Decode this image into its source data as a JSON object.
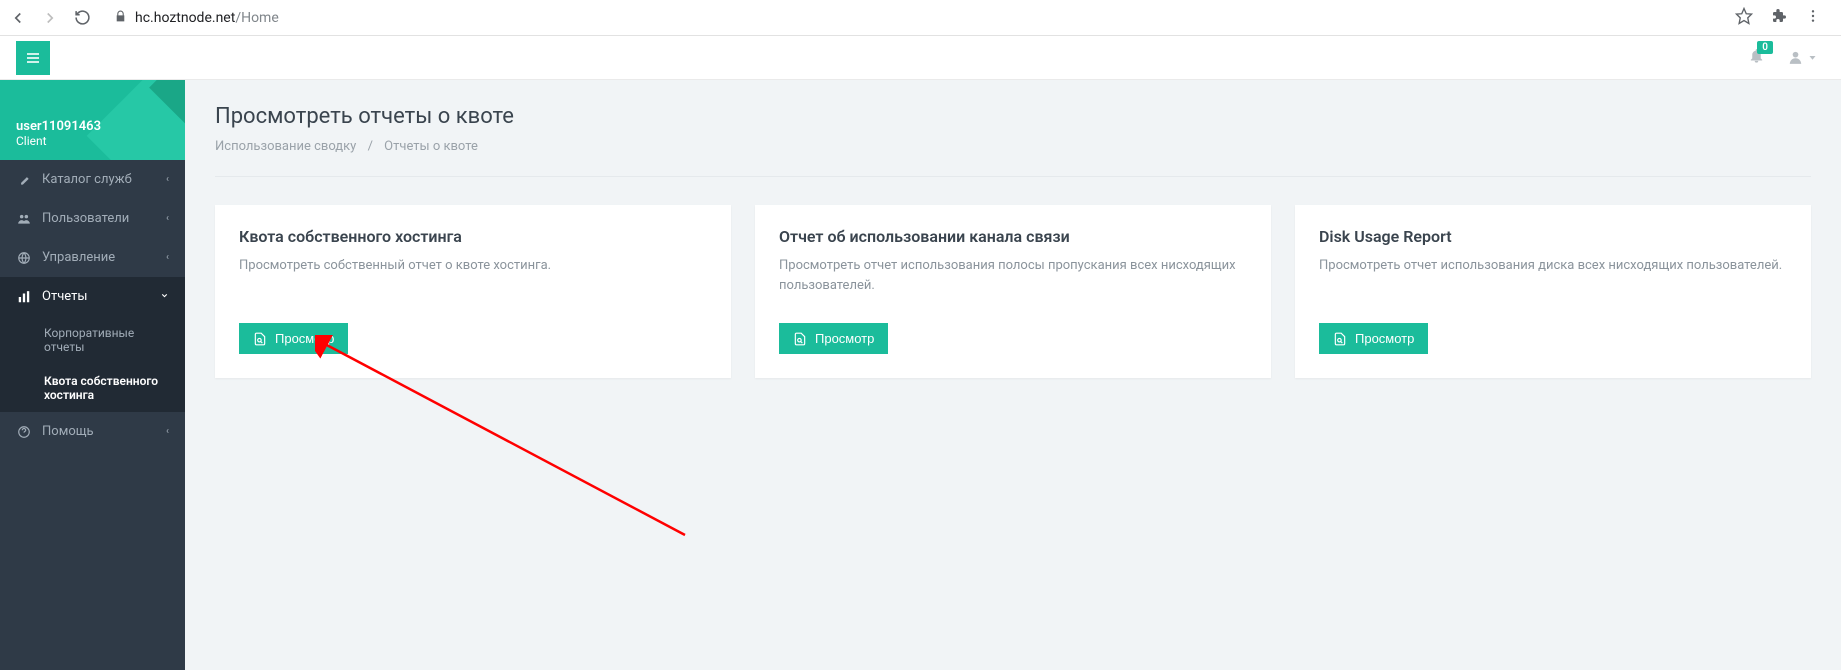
{
  "browser": {
    "url_host": "hc.hoztnode.net",
    "url_path": "/Home"
  },
  "topbar": {
    "notif_count": "0"
  },
  "user": {
    "name": "user11091463",
    "role": "Client"
  },
  "sidebar": {
    "items": [
      {
        "label": "Каталог служб"
      },
      {
        "label": "Пользователи"
      },
      {
        "label": "Управление"
      },
      {
        "label": "Отчеты"
      },
      {
        "label": "Помощь"
      }
    ],
    "sub_reports": [
      {
        "label": "Корпоративные отчеты"
      },
      {
        "label": "Квота собственного хостинга"
      }
    ]
  },
  "page": {
    "title": "Просмотреть отчеты о квоте",
    "crumb1": "Использование сводку",
    "crumb2": "Отчеты о квоте"
  },
  "cards": [
    {
      "title": "Квота собственного хостинга",
      "desc": "Просмотреть собственный отчет о квоте хостинга.",
      "btn": "Просмотр"
    },
    {
      "title": "Отчет об использовании канала связи",
      "desc": "Просмотреть отчет использования полосы пропускания всех нисходящих пользователей.",
      "btn": "Просмотр"
    },
    {
      "title": "Disk Usage Report",
      "desc": "Просмотреть отчет использования диска всех нисходящих пользователей.",
      "btn": "Просмотр"
    }
  ]
}
